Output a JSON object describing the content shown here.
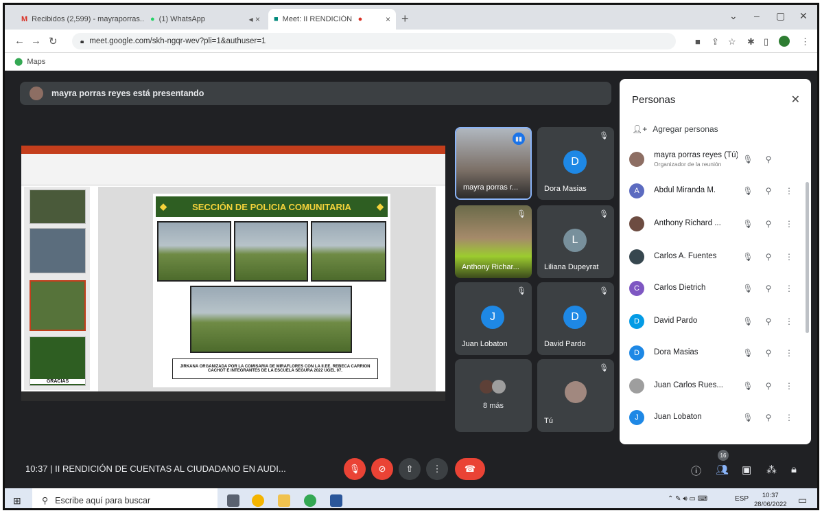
{
  "browser": {
    "tabs": [
      {
        "label": "Recibidos (2,599) - mayraporras...",
        "icon": "gmail-icon"
      },
      {
        "label": "(1) WhatsApp",
        "icon": "whatsapp-icon"
      },
      {
        "label": "Meet: II RENDICIÓN DE CUEN",
        "icon": "meet-icon"
      }
    ],
    "url": "meet.google.com/skh-ngqr-wev?pli=1&authuser=1",
    "bookmark": "Maps"
  },
  "meet": {
    "presenting_text": "mayra porras reyes está presentando",
    "title": "10:37  |  II RENDICIÓN DE CUENTAS AL CIUDADANO EN AUDI...",
    "participants_count": "16"
  },
  "slide": {
    "heading": "SECCIÓN DE POLICIA COMUNITARIA",
    "caption": "JIRKANA ORGANIZADA POR LA COMISARIA DE MIRAFLORES CON LA II.EE. REBECA CARRION CACHOT E INTEGRANTES DE LA ESCUELA SEGURA 2022 UGEL 07.",
    "thumb_last": "GRACIAS"
  },
  "tiles": [
    {
      "name": "mayra porras r...",
      "type": "video"
    },
    {
      "name": "Dora Masias",
      "initial": "D",
      "color": "#1e88e5"
    },
    {
      "name": "Anthony Richar...",
      "type": "video"
    },
    {
      "name": "Liliana Dupeyrat",
      "initial": "L",
      "color": "#78909c"
    },
    {
      "name": "Juan Lobaton",
      "initial": "J",
      "color": "#1e88e5"
    },
    {
      "name": "David Pardo",
      "initial": "D",
      "color": "#1e88e5"
    },
    {
      "name": "8 más"
    },
    {
      "name": "Tú"
    }
  ],
  "panel": {
    "title": "Personas",
    "add_people": "Agregar personas",
    "people": [
      {
        "name": "mayra porras reyes (Tú)",
        "sub": "Organizador de la reunión",
        "initial": "",
        "color": "#8d6e63"
      },
      {
        "name": "Abdul Miranda M.",
        "initial": "A",
        "color": "#5c6bc0"
      },
      {
        "name": "Anthony Richard ...",
        "initial": "",
        "color": "#6d4c41"
      },
      {
        "name": "Carlos A. Fuentes",
        "initial": "",
        "color": "#37474f"
      },
      {
        "name": "Carlos Dietrich",
        "initial": "C",
        "color": "#7e57c2"
      },
      {
        "name": "David Pardo",
        "initial": "D",
        "color": "#039be5"
      },
      {
        "name": "Dora Masias",
        "initial": "D",
        "color": "#1e88e5"
      },
      {
        "name": "Juan Carlos Rues...",
        "initial": "",
        "color": "#9e9e9e"
      },
      {
        "name": "Juan Lobaton",
        "initial": "J",
        "color": "#1e88e5"
      }
    ]
  },
  "taskbar": {
    "search_placeholder": "Escribe aquí para buscar",
    "lang": "ESP",
    "time": "10:37",
    "date": "28/06/2022"
  }
}
